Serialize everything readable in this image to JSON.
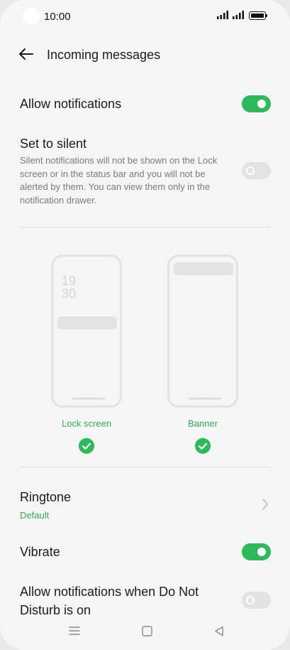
{
  "status_bar": {
    "time": "10:00",
    "icons": [
      "signal-icon",
      "signal-icon",
      "battery-icon"
    ]
  },
  "header": {
    "back_icon": "arrow-left-icon",
    "title": "Incoming messages"
  },
  "settings": {
    "allow_notifications": {
      "label": "Allow notifications",
      "enabled": true
    },
    "set_to_silent": {
      "label": "Set to silent",
      "description": "Silent notifications will not be shown on the Lock screen or in the status bar and you will not be alerted by them. You can view them only in the notification drawer.",
      "enabled": false
    },
    "display_options": [
      {
        "label": "Lock screen",
        "clock_hour": "19",
        "clock_minute": "30",
        "selected": true
      },
      {
        "label": "Banner",
        "selected": true
      }
    ],
    "ringtone": {
      "label": "Ringtone",
      "value": "Default"
    },
    "vibrate": {
      "label": "Vibrate",
      "enabled": true
    },
    "dnd": {
      "label_line1": "Allow notifications when Do Not",
      "label_line2": "Disturb is on",
      "enabled": false
    }
  },
  "navbar": {
    "items": [
      "menu-icon",
      "home-icon",
      "back-triangle-icon"
    ]
  },
  "colors": {
    "accent": "#2eb95a",
    "background": "#f5f5f5"
  }
}
